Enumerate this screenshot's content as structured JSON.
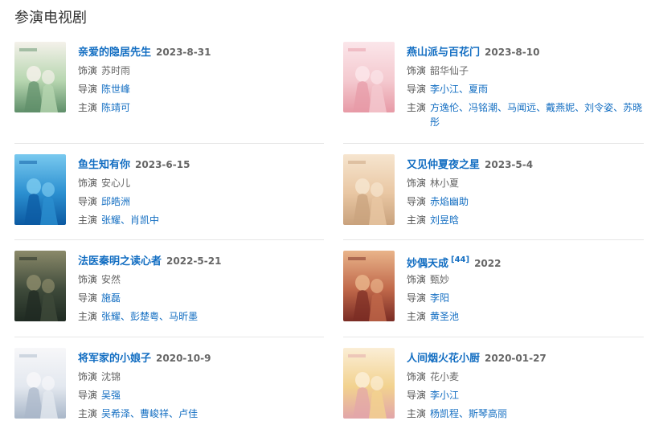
{
  "section_title": "参演电视剧",
  "labels": {
    "role": "饰演",
    "director": "导演",
    "cast": "主演"
  },
  "dramas": [
    {
      "title": "亲爱的隐居先生",
      "date": "2023-8-31",
      "role": "苏时雨",
      "directors": [
        "陈世峰"
      ],
      "cast": [
        "陈靖可"
      ],
      "poster_colors": [
        "#b7d6b0",
        "#5f8f6a",
        "#f4f1ea"
      ]
    },
    {
      "title": "燕山派与百花门",
      "date": "2023-8-10",
      "role": "韶华仙子",
      "directors": [
        "李小江",
        "夏雨"
      ],
      "cast": [
        "方逸伦",
        "冯铭潮",
        "马闻远",
        "戴燕妮",
        "刘令姿",
        "苏晓彤"
      ],
      "poster_colors": [
        "#f4c9cf",
        "#e79aa6",
        "#fbe6ea"
      ]
    },
    {
      "title": "鱼生知有你",
      "date": "2023-6-15",
      "role": "安心儿",
      "directors": [
        "邱皓洲"
      ],
      "cast": [
        "张耀",
        "肖凯中"
      ],
      "poster_colors": [
        "#2b8fd0",
        "#0c5aa2",
        "#79c9ef"
      ]
    },
    {
      "title": "又见仲夏夜之星",
      "date": "2023-5-4",
      "role": "林小夏",
      "directors": [
        "赤焰幽助"
      ],
      "cast": [
        "刘昱晗"
      ],
      "poster_colors": [
        "#e9c7a3",
        "#c9a27d",
        "#f6e5cf"
      ]
    },
    {
      "title": "法医秦明之读心者",
      "date": "2022-5-21",
      "role": "安然",
      "directors": [
        "施磊"
      ],
      "cast": [
        "张耀",
        "彭楚粤",
        "马昕墨"
      ],
      "poster_colors": [
        "#3e4a3a",
        "#1f2a22",
        "#8b8a6a"
      ]
    },
    {
      "title": "妙偶天成",
      "ref": "[44]",
      "date": "2022",
      "role": "甄妙",
      "directors": [
        "李阳"
      ],
      "cast": [
        "黄圣池"
      ],
      "poster_colors": [
        "#c0684a",
        "#7a2c24",
        "#e9b48a"
      ]
    },
    {
      "title": "将军家的小娘子",
      "date": "2020-10-9",
      "role": "沈锦",
      "directors": [
        "吴强"
      ],
      "cast": [
        "吴希泽",
        "曹峻祥",
        "卢佳"
      ],
      "poster_colors": [
        "#e3e8ef",
        "#a9b7c9",
        "#f7f7f9"
      ]
    },
    {
      "title": "人间烟火花小厨",
      "date": "2020-01-27",
      "role": "花小麦",
      "directors": [
        "李小江"
      ],
      "cast": [
        "杨凯程",
        "斯琴高丽"
      ],
      "poster_colors": [
        "#f2d28f",
        "#e2a5a9",
        "#fbeed6"
      ]
    }
  ]
}
